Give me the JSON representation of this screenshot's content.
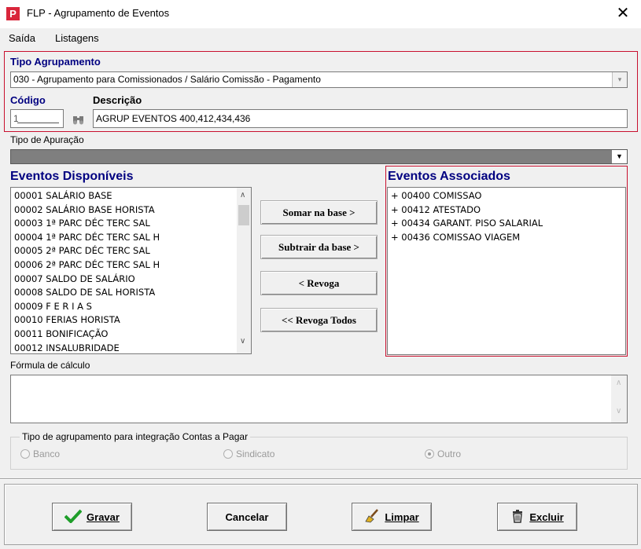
{
  "window": {
    "title": "FLP - Agrupamento de Eventos",
    "close_glyph": "✕",
    "app_icon_letter": "P"
  },
  "menu": {
    "items": [
      "Saída",
      "Listagens"
    ]
  },
  "tipo_agrupamento": {
    "label": "Tipo Agrupamento",
    "value": "030 - Agrupamento para Comissionados / Salário Comissão - Pagamento"
  },
  "codigo": {
    "label": "Código",
    "value": "1"
  },
  "descricao": {
    "label": "Descrição",
    "value": "AGRUP EVENTOS 400,412,434,436"
  },
  "tipo_apuracao": {
    "label": "Tipo de Apuração",
    "value": ""
  },
  "eventos_disponiveis": {
    "title": "Eventos Disponíveis",
    "items": [
      "00001 SALÁRIO BASE",
      "00002 SALÁRIO BASE HORISTA",
      "00003 1ª PARC DÉC TERC SAL",
      "00004 1ª PARC DÉC TERC SAL H",
      "00005 2ª PARC DÉC TERC SAL",
      "00006 2ª PARC DÉC TERC SAL H",
      "00007 SALDO DE SALÁRIO",
      "00008 SALDO DE SAL HORISTA",
      "00009 F E R I A S",
      "00010 FERIAS HORISTA",
      "00011 BONIFICAÇÃO",
      "00012 INSALUBRIDADE"
    ]
  },
  "eventos_associados": {
    "title": "Eventos Associados",
    "items": [
      "+ 00400 COMISSAO",
      "+ 00412 ATESTADO",
      "+ 00434 GARANT. PISO SALARIAL",
      "+ 00436 COMISSAO  VIAGEM"
    ]
  },
  "actions": {
    "somar": "Somar  na base >",
    "subtrair": "Subtrair da base >",
    "revoga": "< Revoga",
    "revoga_todos": "<< Revoga Todos"
  },
  "formula": {
    "label": "Fórmula de cálculo",
    "value": ""
  },
  "integracao": {
    "label": "Tipo de agrupamento para integração Contas a Pagar",
    "options": [
      {
        "label": "Banco",
        "checked": false
      },
      {
        "label": "Sindicato",
        "checked": false
      },
      {
        "label": "Outro",
        "checked": true
      }
    ]
  },
  "buttons": {
    "gravar": "Gravar",
    "cancelar": "Cancelar",
    "limpar": "Limpar",
    "excluir": "Excluir"
  },
  "colors": {
    "section_border": "#c8102e",
    "label_blue": "#000080",
    "check_green": "#1f9e2a"
  }
}
